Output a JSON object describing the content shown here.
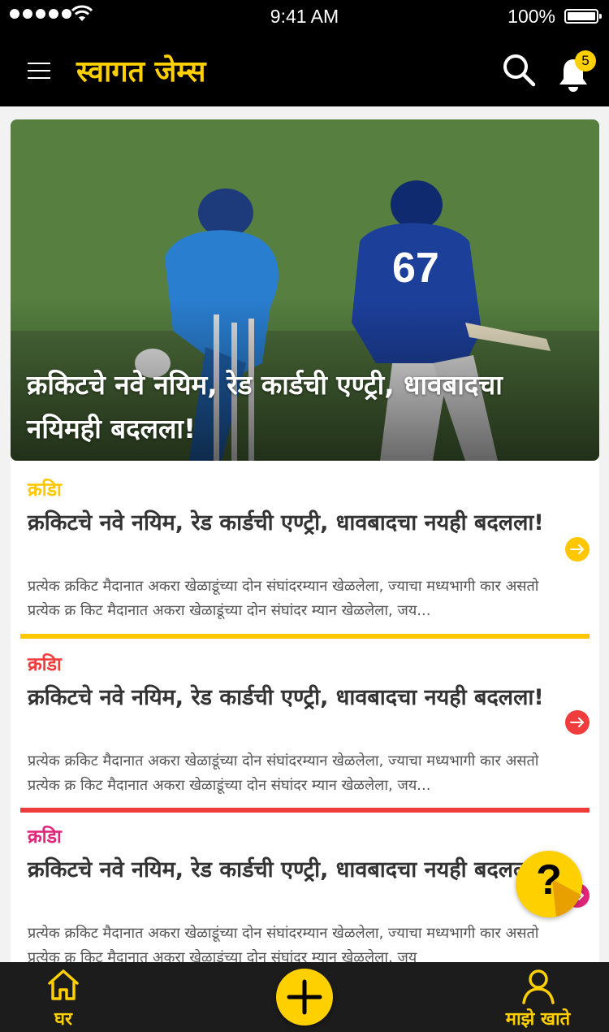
{
  "status_bar": {
    "time": "9:41 AM",
    "battery": "100%"
  },
  "header": {
    "title": "स्वागत जेम्स",
    "notifications_count": "5"
  },
  "hero": {
    "title": "क्रकिटचे नवे नयिम, रेड कार्डची एण्ट्री, धावबादचा नयिमही बदलला!"
  },
  "articles": [
    {
      "category": "क्रडिा",
      "headline": "क्रकिटचे नवे नयिम, रेड कार्डची एण्ट्री, धावबादचा नयही बदलला!",
      "excerpt": "प्रत्येक क्रकिट मैदानात अकरा खेळाडूंच्या दोन संघांदरम्यान खेळलेला, ज्याचा मध्यभागी कार असतो प्रत्येक क्र किट मैदानात अकरा खेळाडूंच्या दोन संघांदर म्यान खेळलेला, जय...",
      "accent": "#ffc700"
    },
    {
      "category": "क्रडिा",
      "headline": "क्रकिटचे नवे नयिम, रेड कार्डची एण्ट्री, धावबादचा नयही बदलला!",
      "excerpt": "प्रत्येक क्रकिट मैदानात अकरा खेळाडूंच्या दोन संघांदरम्यान खेळलेला, ज्याचा मध्यभागी कार असतो प्रत्येक क्र किट मैदानात अकरा खेळाडूंच्या दोन संघांदर म्यान खेळलेला, जय...",
      "accent": "#f03c3c"
    },
    {
      "category": "क्रडिा",
      "headline": "क्रकिटचे नवे नयिम, रेड कार्डची एण्ट्री, धावबादचा नयही बदलला!",
      "excerpt": "प्रत्येक क्रकिट मैदानात अकरा खेळाडूंच्या दोन संघांदरम्यान खेळलेला, ज्याचा मध्यभागी कार असतो प्रत्येक क्र किट मैदानात अकरा खेळाडूंच्या दोन संघांदर म्यान खेळलेला, जय",
      "accent": "#e0267a"
    }
  ],
  "bottom_nav": {
    "home_label": "घर",
    "account_label": "माझे खाते"
  },
  "icons": {
    "menu": "menu-icon",
    "search": "search-icon",
    "bell": "bell-icon",
    "arrow": "arrow-right-icon",
    "help": "help-icon",
    "home": "home-icon",
    "plus": "plus-icon",
    "user": "user-icon"
  },
  "colors": {
    "brand_yellow": "#ffd000",
    "header_bg": "#000000",
    "nav_bg": "#1c1c1c"
  }
}
